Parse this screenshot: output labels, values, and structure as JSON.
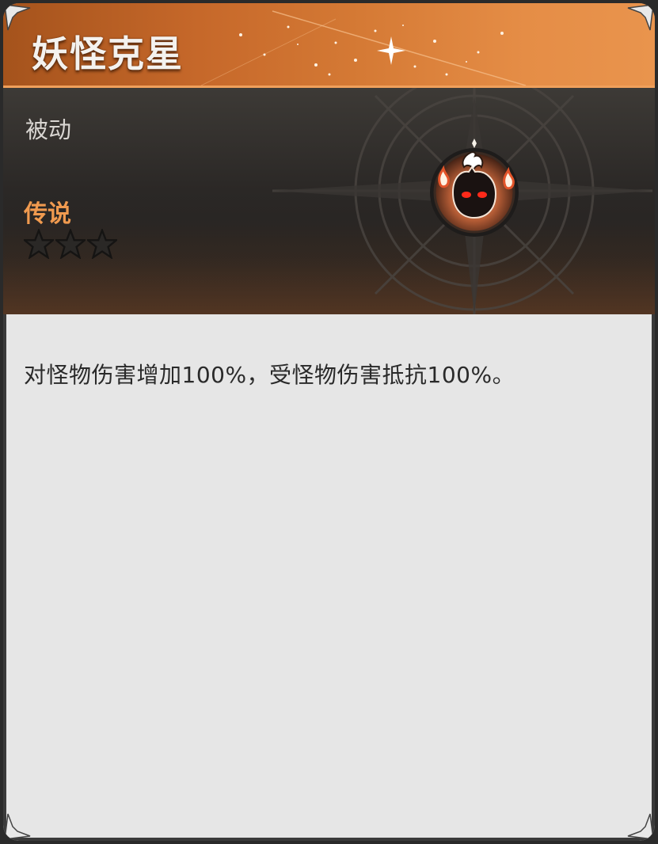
{
  "skill": {
    "name": "妖怪克星",
    "type": "被动",
    "rarity": "传说",
    "stars_filled": 0,
    "stars_total": 3,
    "icon": "monster-flame-icon",
    "description": "对怪物伤害增加100%，受怪物伤害抵抗100%。"
  },
  "colors": {
    "title_bar": "#d57a35",
    "rarity": "#f09a4f",
    "panel_dark": "#2b2826",
    "body_bg": "#e6e6e6"
  }
}
